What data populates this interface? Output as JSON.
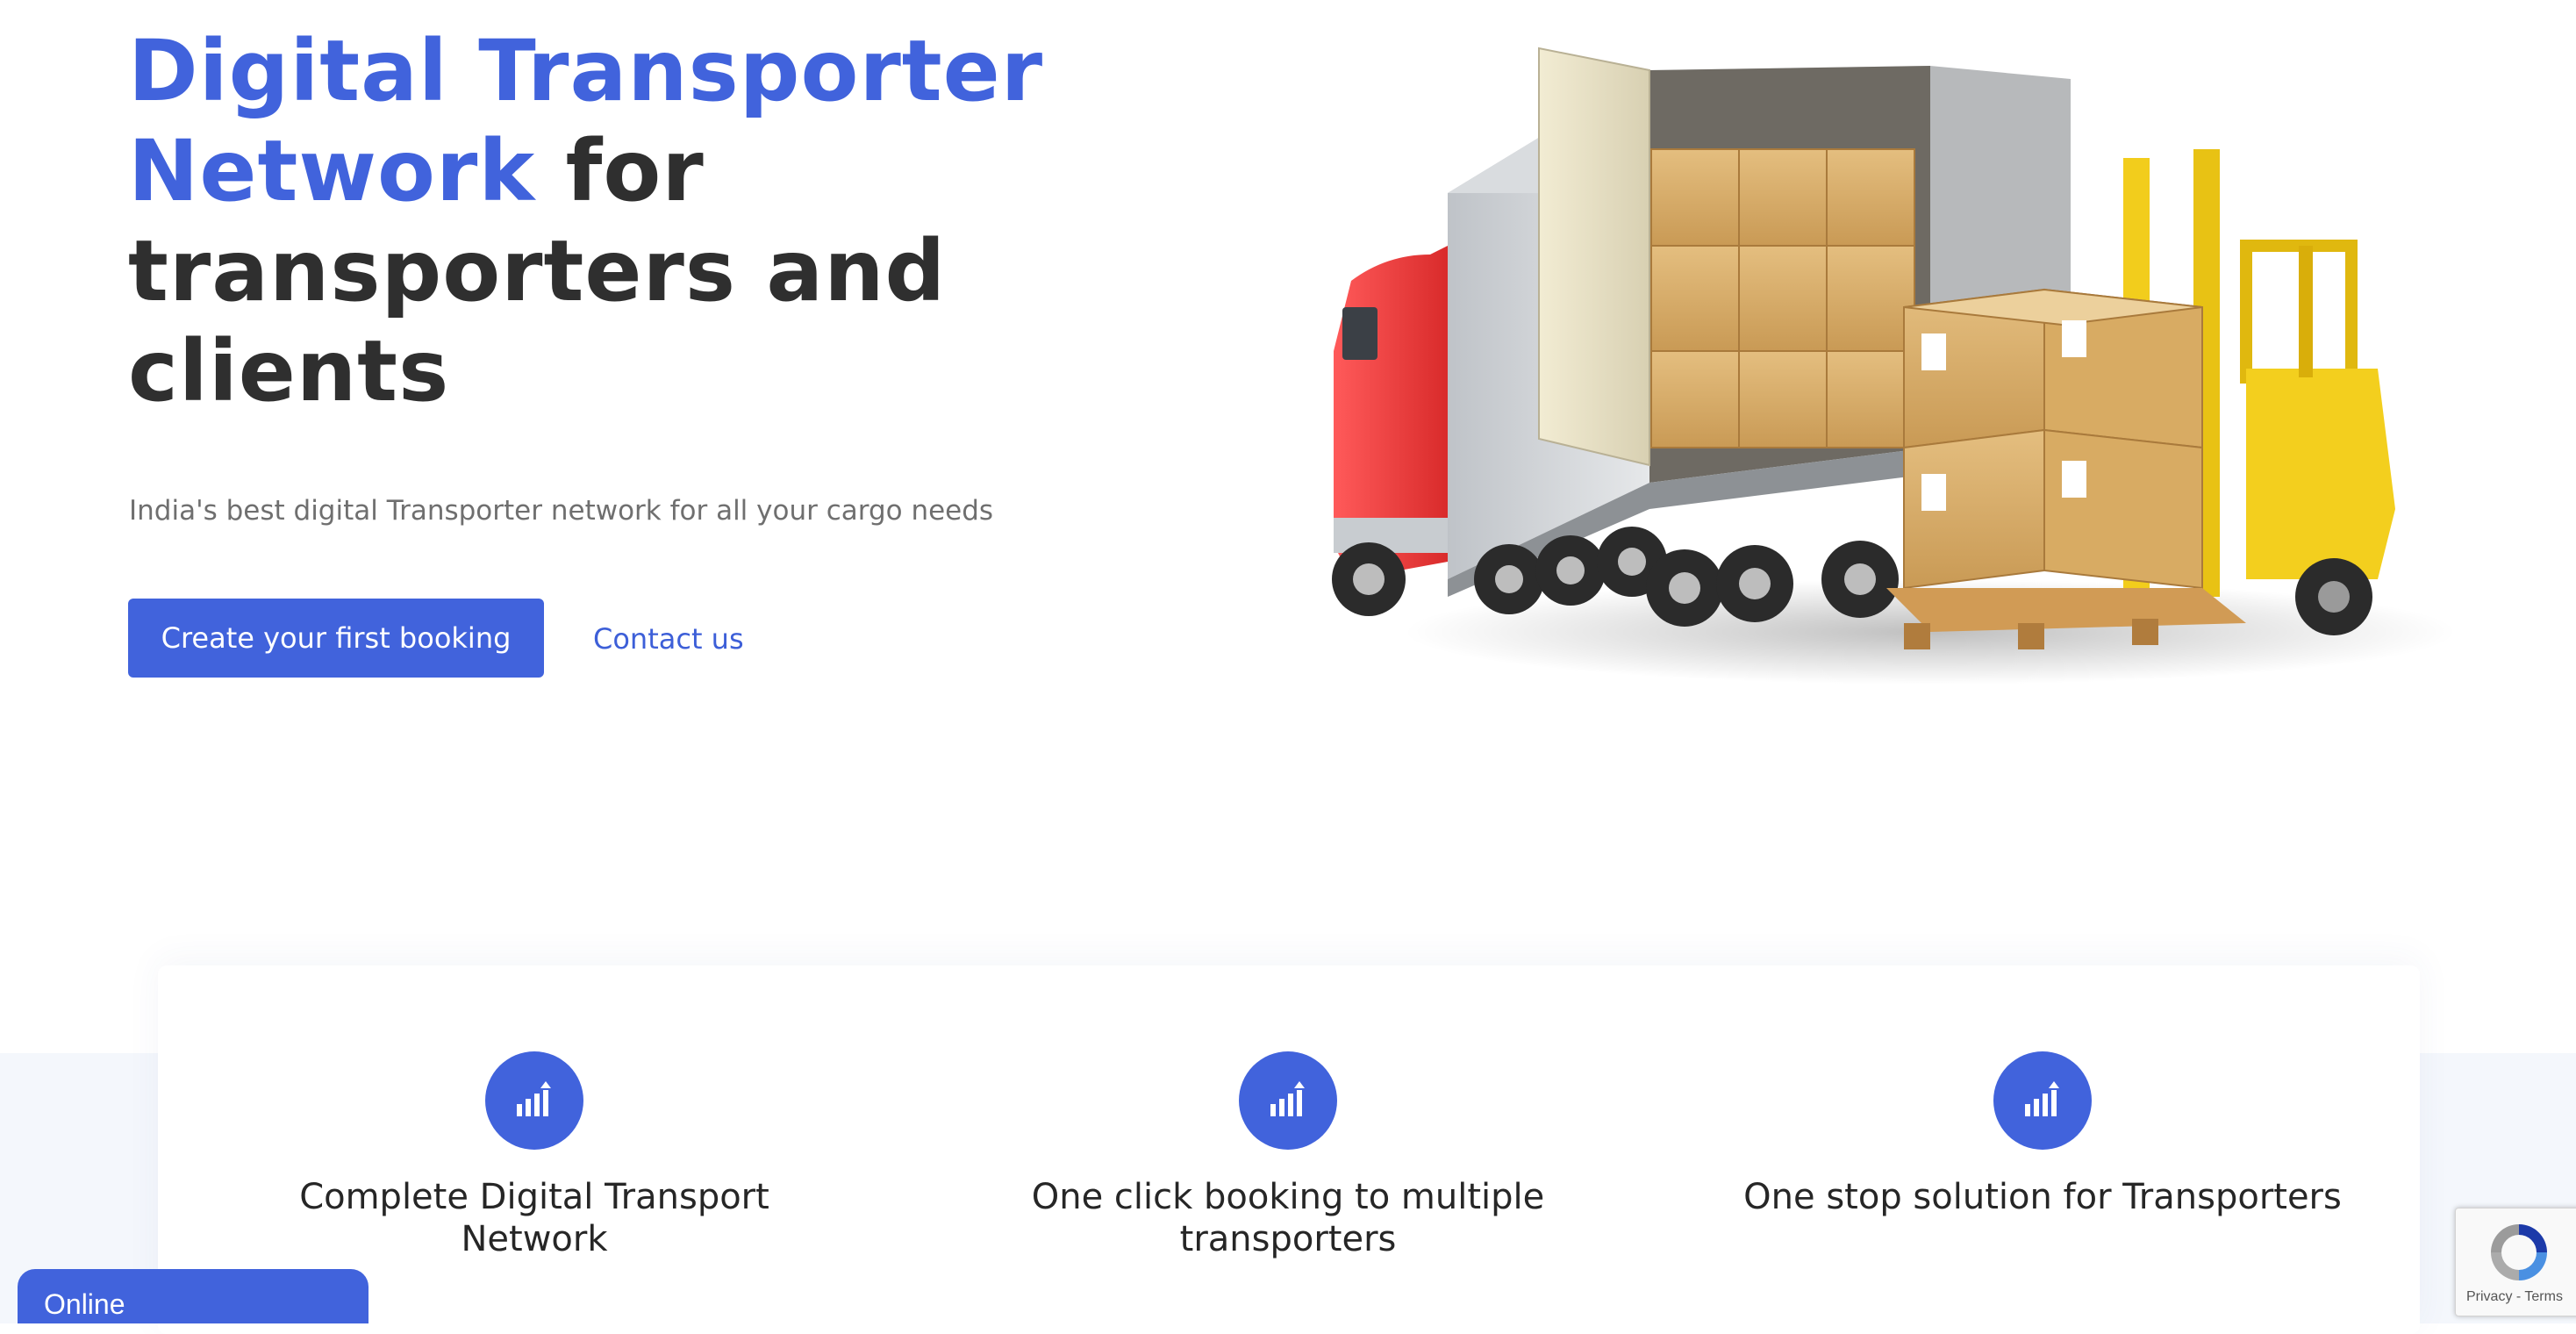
{
  "hero": {
    "title_accent": "Digital Transporter Network",
    "title_rest": " for transporters and clients",
    "subtitle": "India's best digital Transporter network for all your cargo needs",
    "primary_button": "Create your first booking",
    "contact_link": "Contact us",
    "illustration": "truck-with-forklift-and-cargo-boxes"
  },
  "features": [
    {
      "icon": "bar-chart-growth-icon",
      "title": "Complete Digital Transport Network"
    },
    {
      "icon": "bar-chart-growth-icon",
      "title": "One click booking to multiple transporters"
    },
    {
      "icon": "bar-chart-growth-icon",
      "title": "One stop solution for Transporters"
    }
  ],
  "chat": {
    "label": "Online"
  },
  "recaptcha": {
    "privacy": "Privacy",
    "separator": " - ",
    "terms": "Terms"
  },
  "colors": {
    "accent": "#4163dc",
    "heading": "#2f2f2f",
    "subtitle": "#6f6f6f",
    "band": "#f4f7fc"
  }
}
